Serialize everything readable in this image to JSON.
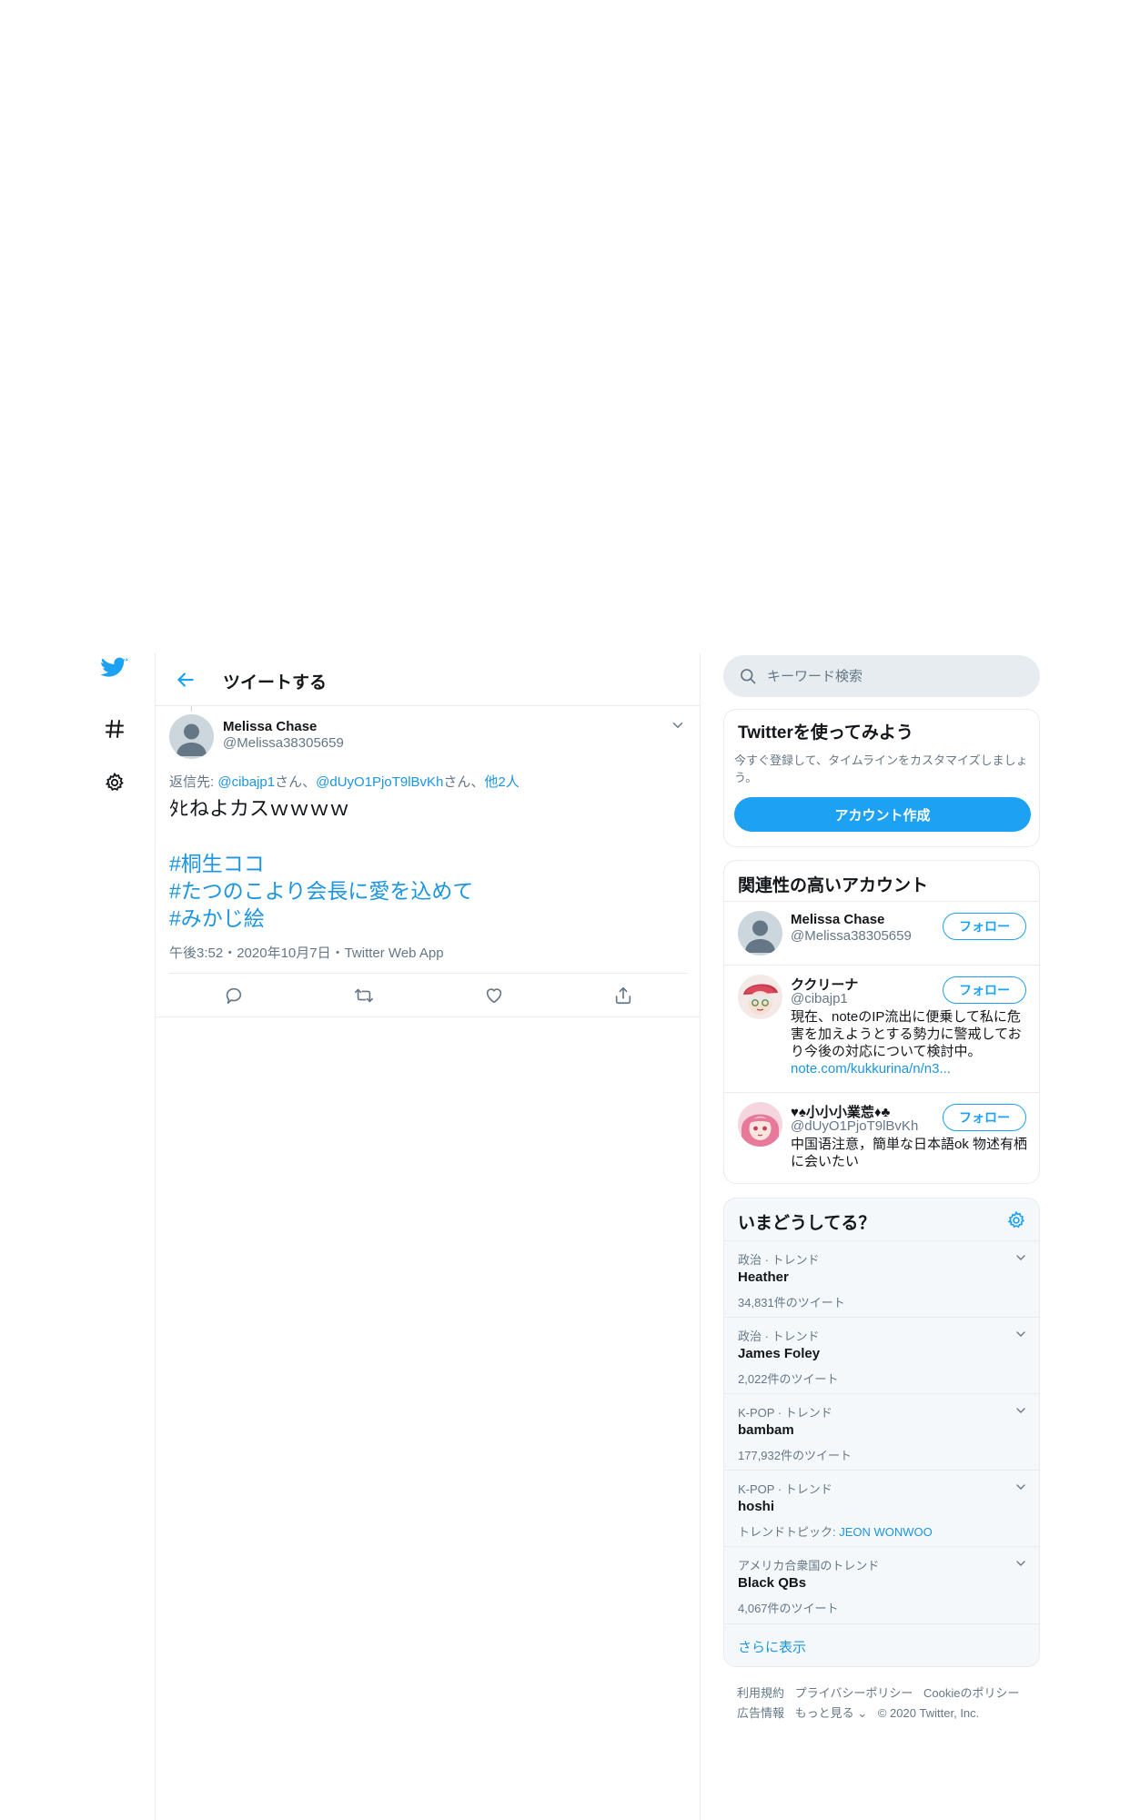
{
  "nav": {
    "icons": [
      "twitter-bird-icon",
      "hashtag-icon",
      "gear-icon"
    ]
  },
  "header": {
    "title": "ツイートする"
  },
  "tweet": {
    "author_name": "Melissa Chase",
    "author_handle": "@Melissa38305659",
    "reply_prefix": "返信先: ",
    "reply_mention_1": "@cibajp1",
    "reply_sep_1": "さん、",
    "reply_mention_2": "@dUyO1PjoT9lBvKh",
    "reply_sep_2": "さん、",
    "reply_others": "他2人",
    "text": "ﾀﾋねよカスｗｗｗｗ",
    "hashtags": [
      "#桐生ココ",
      "#たつのこより会長に愛を込めて",
      "#みかじ絵"
    ],
    "meta": "午後3:52・2020年10月7日・Twitter Web App"
  },
  "search": {
    "placeholder": "キーワード検索"
  },
  "signup": {
    "title": "Twitterを使ってみよう",
    "description": "今すぐ登録して、タイムラインをカスタマイズしましょう。",
    "button": "アカウント作成"
  },
  "related": {
    "title": "関連性の高いアカウント",
    "follow_label": "フォロー",
    "accounts": [
      {
        "name": "Melissa Chase",
        "handle": "@Melissa38305659",
        "bio": "",
        "link": ""
      },
      {
        "name": "ククリーナ",
        "handle": "@cibajp1",
        "bio": "現在、noteのIP流出に便乗して私に危害を加えようとする勢力に警戒しており今後の対応について検討中。",
        "link": "note.com/kukkurina/n/n3..."
      },
      {
        "name": "♥♠小小小業莣♦♣",
        "handle": "@dUyO1PjoT9lBvKh",
        "bio": "中国语注意，簡単な日本語ok 物述有栖に会いたい",
        "link": ""
      }
    ]
  },
  "trends": {
    "title": "いまどうしてる？",
    "items": [
      {
        "category": "政治 · トレンド",
        "name": "Heather",
        "count": "34,831件のツイート",
        "topic_label": "",
        "topic": ""
      },
      {
        "category": "政治 · トレンド",
        "name": "James Foley",
        "count": "2,022件のツイート",
        "topic_label": "",
        "topic": ""
      },
      {
        "category": "K-POP · トレンド",
        "name": "bambam",
        "count": "177,932件のツイート",
        "topic_label": "",
        "topic": ""
      },
      {
        "category": "K-POP · トレンド",
        "name": "hoshi",
        "count": "",
        "topic_label": "トレンドトピック: ",
        "topic": "JEON WONWOO"
      },
      {
        "category": "アメリカ合衆国のトレンド",
        "name": "Black QBs",
        "count": "4,067件のツイート",
        "topic_label": "",
        "topic": ""
      }
    ],
    "show_more": "さらに表示"
  },
  "footer": {
    "terms": "利用規約",
    "privacy": "プライバシーポリシー",
    "cookies": "Cookieのポリシー",
    "ads": "広告情報",
    "more": "もっと見る",
    "copyright": "© 2020 Twitter, Inc."
  },
  "colors": {
    "accent": "#1da1f2",
    "link": "#1b95e0",
    "muted": "#657786",
    "border": "#e6ecf0"
  }
}
